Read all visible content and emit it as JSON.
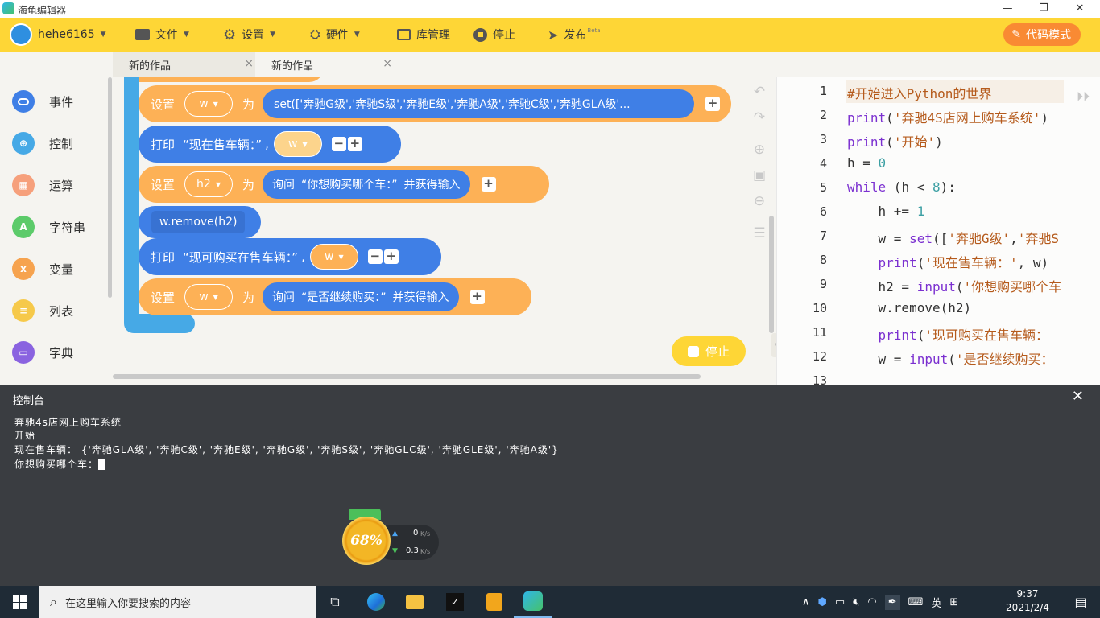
{
  "app": {
    "title": "海龟编辑器",
    "window_controls": [
      "—",
      "❐",
      "✕"
    ]
  },
  "toolbar": {
    "username": "hehe6165",
    "file": "文件",
    "settings": "设置",
    "hardware": "硬件",
    "library": "库管理",
    "stop": "停止",
    "publish": "发布",
    "publish_badge": "Beta",
    "code_mode": "代码模式"
  },
  "tabs": [
    {
      "label": "新的作品",
      "close": "×"
    },
    {
      "label": "新的作品",
      "close": "×"
    }
  ],
  "sidebar": {
    "items": [
      {
        "label": "事件",
        "color": "#3f7fe6"
      },
      {
        "label": "控制",
        "color": "#46a9e6"
      },
      {
        "label": "运算",
        "color": "#f6a07c"
      },
      {
        "label": "字符串",
        "color": "#5ccb6a"
      },
      {
        "label": "变量",
        "color": "#f6a34f"
      },
      {
        "label": "列表",
        "color": "#f6c94a"
      },
      {
        "label": "字典",
        "color": "#8a63e0"
      }
    ]
  },
  "blocks": {
    "set1": {
      "kw": "设置",
      "var": "w",
      "as": "为",
      "value": "set(['奔驰G级','奔驰S级','奔驰E级','奔驰A级','奔驰C级','奔驰GLA级'..."
    },
    "print1": {
      "kw": "打印",
      "text": "“现在售车辆：”",
      "comma": ",",
      "var": "w"
    },
    "set2": {
      "kw": "设置",
      "var": "h2",
      "as": "为",
      "ask": "询问",
      "prompt": "“你想购买哪个车：”",
      "tail": "并获得输入"
    },
    "remove": {
      "text": "w.remove(h2)"
    },
    "print2": {
      "kw": "打印",
      "text": "“现可购买在售车辆：”",
      "comma": ",",
      "var": "w"
    },
    "set3": {
      "kw": "设置",
      "var": "w",
      "as": "为",
      "ask": "询问",
      "prompt": "“是否继续购买：”",
      "tail": "并获得输入"
    }
  },
  "stop_float": "停止",
  "code": {
    "line_numbers": [
      "1",
      "2",
      "3",
      "4",
      "5",
      "6",
      "7",
      "8",
      "9",
      "10",
      "11",
      "12",
      "13"
    ],
    "lines": [
      [
        [
          "cmt",
          "#开始进入Python的世界"
        ]
      ],
      [
        [
          "kw",
          "print"
        ],
        [
          "p",
          "("
        ],
        [
          "str",
          "'奔驰4S店网上购车系统'"
        ],
        [
          "p",
          ")"
        ]
      ],
      [
        [
          "kw",
          "print"
        ],
        [
          "p",
          "("
        ],
        [
          "str",
          "'开始'"
        ],
        [
          "p",
          ")"
        ]
      ],
      [
        [
          "p",
          "h = "
        ],
        [
          "num",
          "0"
        ]
      ],
      [
        [
          "kw",
          "while"
        ],
        [
          "p",
          " (h < "
        ],
        [
          "num",
          "8"
        ],
        [
          "p",
          "):"
        ]
      ],
      [
        [
          "p",
          "    h += "
        ],
        [
          "num",
          "1"
        ]
      ],
      [
        [
          "p",
          "    w = "
        ],
        [
          "kw",
          "set"
        ],
        [
          "p",
          "(["
        ],
        [
          "str",
          "'奔驰G级'"
        ],
        [
          "p",
          ","
        ],
        [
          "str",
          "'奔驰S"
        ]
      ],
      [
        [
          "p",
          "    "
        ],
        [
          "kw",
          "print"
        ],
        [
          "p",
          "("
        ],
        [
          "str",
          "'现在售车辆：'"
        ],
        [
          "p",
          ", w)"
        ]
      ],
      [
        [
          "p",
          "    h2 = "
        ],
        [
          "kw",
          "input"
        ],
        [
          "p",
          "("
        ],
        [
          "str",
          "'你想购买哪个车"
        ]
      ],
      [
        [
          "p",
          "    w.remove(h2)"
        ]
      ],
      [
        [
          "p",
          "    "
        ],
        [
          "kw",
          "print"
        ],
        [
          "p",
          "("
        ],
        [
          "str",
          "'现可购买在售车辆："
        ]
      ],
      [
        [
          "p",
          "    w = "
        ],
        [
          "kw",
          "input"
        ],
        [
          "p",
          "("
        ],
        [
          "str",
          "'是否继续购买："
        ]
      ],
      [
        [
          "p",
          ""
        ]
      ]
    ]
  },
  "console": {
    "title": "控制台",
    "close": "✕",
    "lines": [
      "奔驰4s店网上购车系统",
      "开始",
      "现在售车辆： {'奔驰GLA级', '奔驰C级', '奔驰E级', '奔驰G级', '奔驰S级', '奔驰GLC级', '奔驰GLE级', '奔驰A级'}",
      "你想购买哪个车："
    ]
  },
  "net_widget": {
    "percent": "68%",
    "up": "0",
    "down": "0.3",
    "unit": "K/s"
  },
  "taskbar": {
    "search_placeholder": "在这里输入你要搜索的内容",
    "ime": "英",
    "time": "9:37",
    "date": "2021/2/4"
  }
}
